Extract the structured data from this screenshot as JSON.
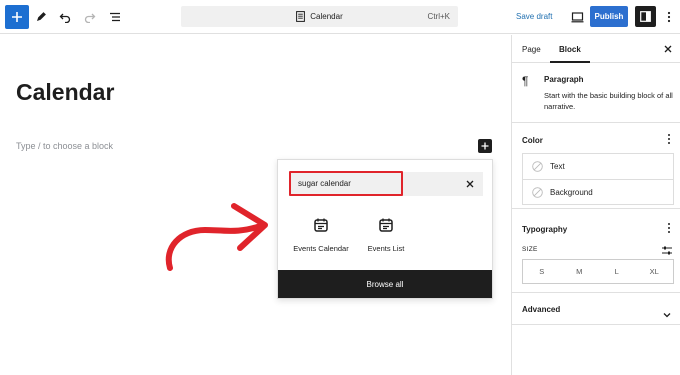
{
  "toolbar": {
    "document_title": "Calendar",
    "shortcut": "Ctrl+K",
    "save_draft": "Save draft",
    "publish": "Publish"
  },
  "editor": {
    "post_title": "Calendar",
    "placeholder": "Type / to choose a block"
  },
  "inserter": {
    "search_value": "sugar calendar",
    "results": [
      {
        "label": "Events Calendar"
      },
      {
        "label": "Events List"
      }
    ],
    "browse_all": "Browse all"
  },
  "sidebar": {
    "tabs": [
      {
        "label": "Page"
      },
      {
        "label": "Block"
      }
    ],
    "active_tab": "Block",
    "block": {
      "title": "Paragraph",
      "description": "Start with the basic building block of all narrative."
    },
    "color": {
      "title": "Color",
      "items": [
        {
          "label": "Text"
        },
        {
          "label": "Background"
        }
      ]
    },
    "typography": {
      "title": "Typography",
      "size_label": "SIZE",
      "sizes": [
        "S",
        "M",
        "L",
        "XL"
      ]
    },
    "advanced": {
      "title": "Advanced"
    }
  },
  "colors": {
    "accent": "#2c6fcf",
    "highlight": "#e0242b",
    "dark": "#1e1e1e"
  }
}
